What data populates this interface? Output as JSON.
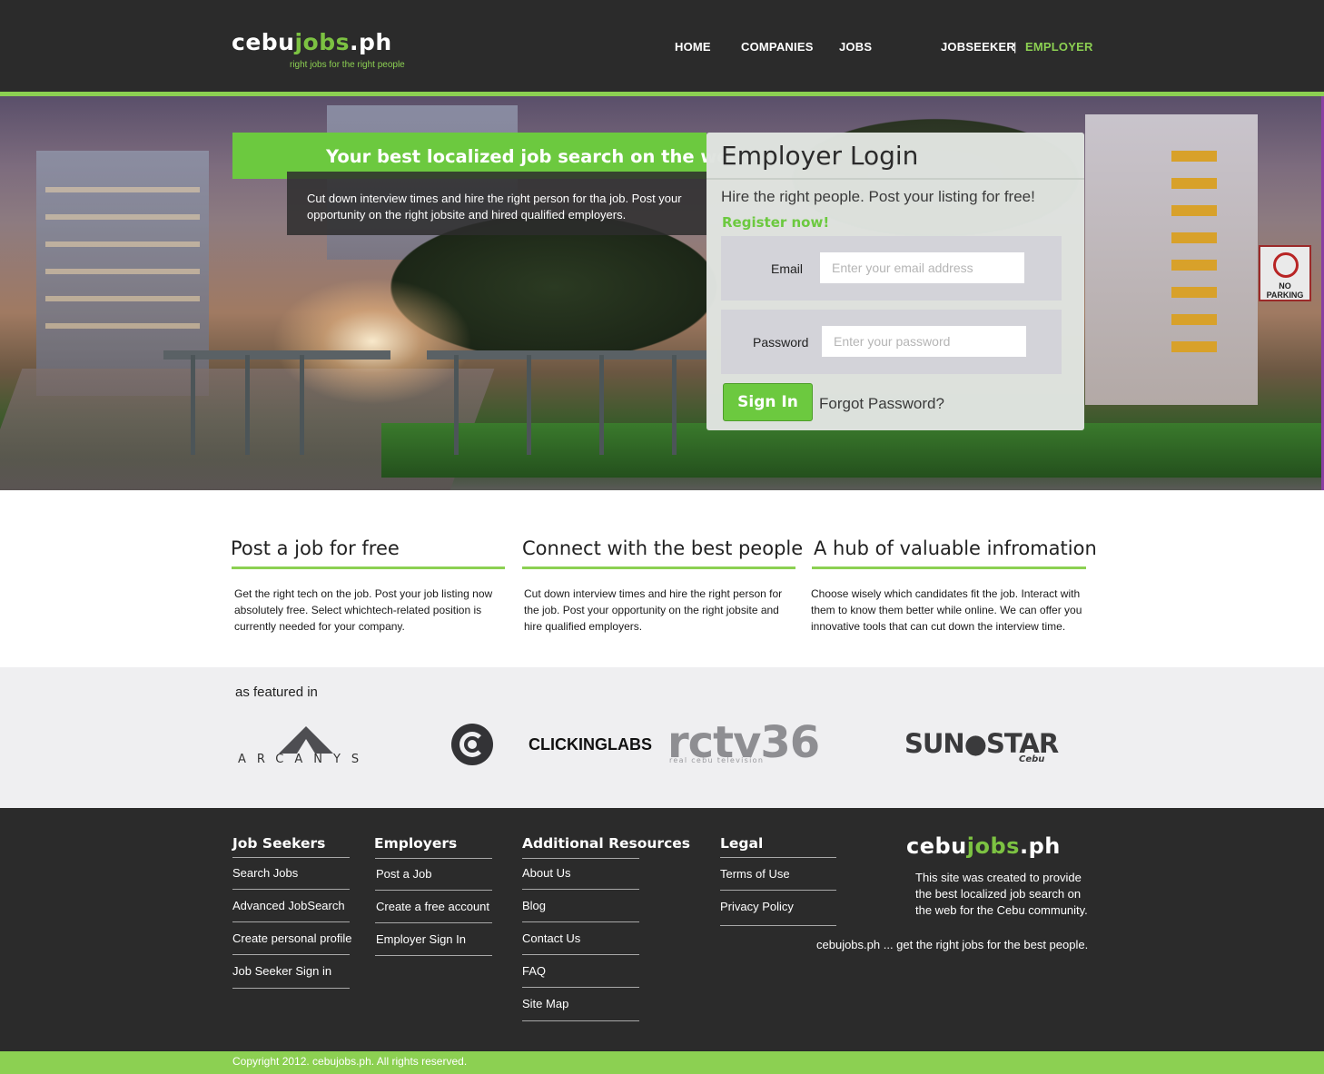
{
  "header": {
    "logo_white": "cebu",
    "logo_green": "jobs",
    "logo_suffix": ".ph",
    "tagline": "right jobs for the right people",
    "nav": [
      "HOME",
      "COMPANIES",
      "JOBS"
    ],
    "jobseeker": "JOBSEEKER",
    "separator": "|",
    "employer": "EMPLOYER"
  },
  "hero": {
    "headline": "Your best localized job search on the web.",
    "description": "Cut down interview times and hire the right person for tha job. Post your opportunity on the right jobsite and hired qualified  employers.",
    "sign_top": "NO",
    "sign_bottom": "PARKING"
  },
  "login": {
    "title": "Employer Login",
    "subtitle": "Hire the right people. Post your listing for free!",
    "register": "Register now!",
    "email_label": "Email",
    "email_placeholder": "Enter your email address",
    "password_label": "Password",
    "password_placeholder": "Enter your password",
    "signin": "Sign In",
    "forgot": "Forgot Password?"
  },
  "features": [
    {
      "title": "Post a job for free",
      "text": "Get the right tech on the job. Post your job listing now absolutely free. Select whichtech-related position is currently needed for your company."
    },
    {
      "title": "Connect with the best people",
      "text": "Cut down interview times and hire the right person for the job. Post your opportunity on the right jobsite and hire qualified employers."
    },
    {
      "title": "A hub of valuable infromation",
      "text": "Choose wisely which candidates fit the job. Interact  with them to know them better while online. We can offer you innovative tools that can cut down the interview time."
    }
  ],
  "featured": {
    "label": "as featured in",
    "arcanys": "ARCANYS",
    "clickinglabs": "CLICKINGLABS",
    "rctv": "rctv36",
    "rctv_sub": "real cebu television",
    "sunstar": "SUN●STAR",
    "sunstar_sub": "Cebu"
  },
  "footer": {
    "columns": [
      {
        "title": "Job Seekers",
        "links": [
          "Search Jobs",
          "Advanced JobSearch",
          "Create personal profile",
          "Job Seeker Sign in"
        ]
      },
      {
        "title": "Employers",
        "links": [
          "Post a Job",
          "Create a free account",
          "Employer Sign In"
        ]
      },
      {
        "title": "Additional Resources",
        "links": [
          "About Us",
          "Blog",
          "Contact Us",
          "FAQ",
          "Site Map"
        ]
      },
      {
        "title": "Legal",
        "links": [
          "Terms of Use",
          "Privacy Policy"
        ]
      }
    ],
    "logo_white": "cebu",
    "logo_green": "jobs",
    "logo_suffix": ".ph",
    "description": "This site was created to provide the best localized job search on the web for the Cebu community.",
    "slogan": "cebujobs.ph ... get the right jobs for the best people.",
    "copyright": "Copyright 2012. cebujobs.ph. All rights reserved."
  }
}
